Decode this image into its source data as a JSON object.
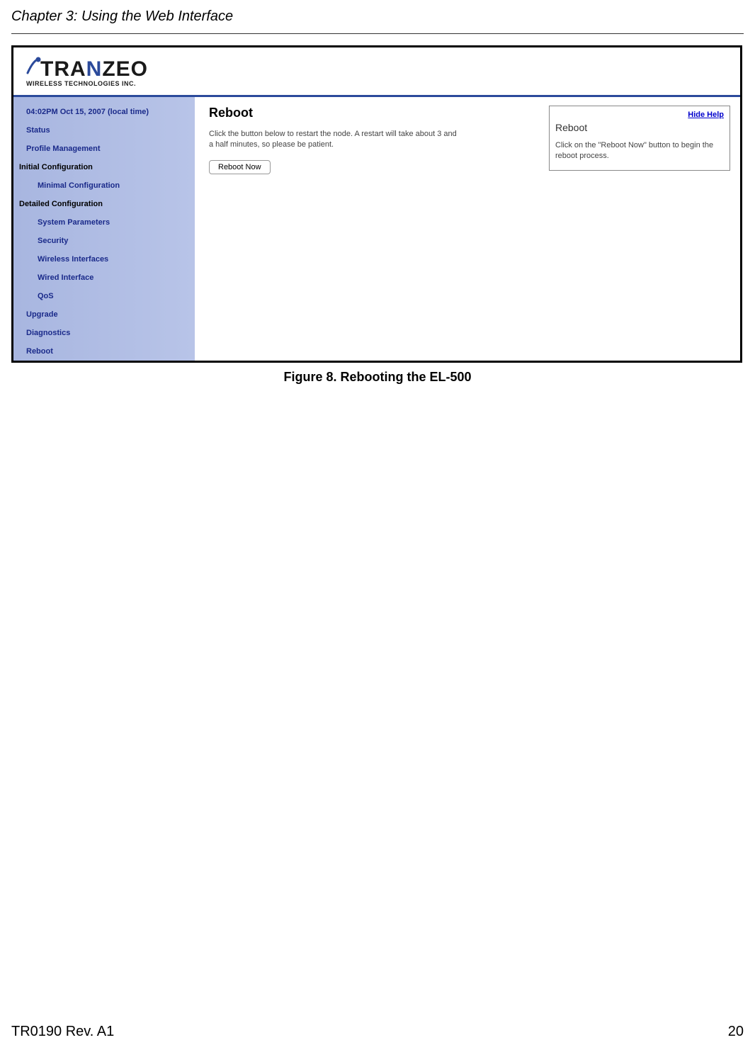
{
  "chapter_header": "Chapter 3: Using the Web Interface",
  "brand": {
    "part1": "TRA",
    "part2": "N",
    "part3": "ZEO",
    "sub": "WIRELESS  TECHNOLOGIES INC."
  },
  "sidebar": {
    "time": "04:02PM Oct 15, 2007 (local time)",
    "status": "Status",
    "profile": "Profile Management",
    "initial_heading": "Initial Configuration",
    "minimal": "Minimal Configuration",
    "detailed_heading": "Detailed Configuration",
    "system_params": "System Parameters",
    "security": "Security",
    "wireless": "Wireless Interfaces",
    "wired": "Wired Interface",
    "qos": "QoS",
    "upgrade": "Upgrade",
    "diagnostics": "Diagnostics",
    "reboot": "Reboot"
  },
  "main": {
    "title": "Reboot",
    "desc": "Click the button below to restart the node. A restart will take about 3 and a half minutes, so please be patient.",
    "button_label": "Reboot Now"
  },
  "help": {
    "hide_label": "Hide Help",
    "title": "Reboot",
    "text": "Click on the \"Reboot Now\" button to begin the reboot process."
  },
  "figure_caption": "Figure 8. Rebooting the EL-500",
  "footer": {
    "left": "TR0190 Rev. A1",
    "right": "20"
  }
}
